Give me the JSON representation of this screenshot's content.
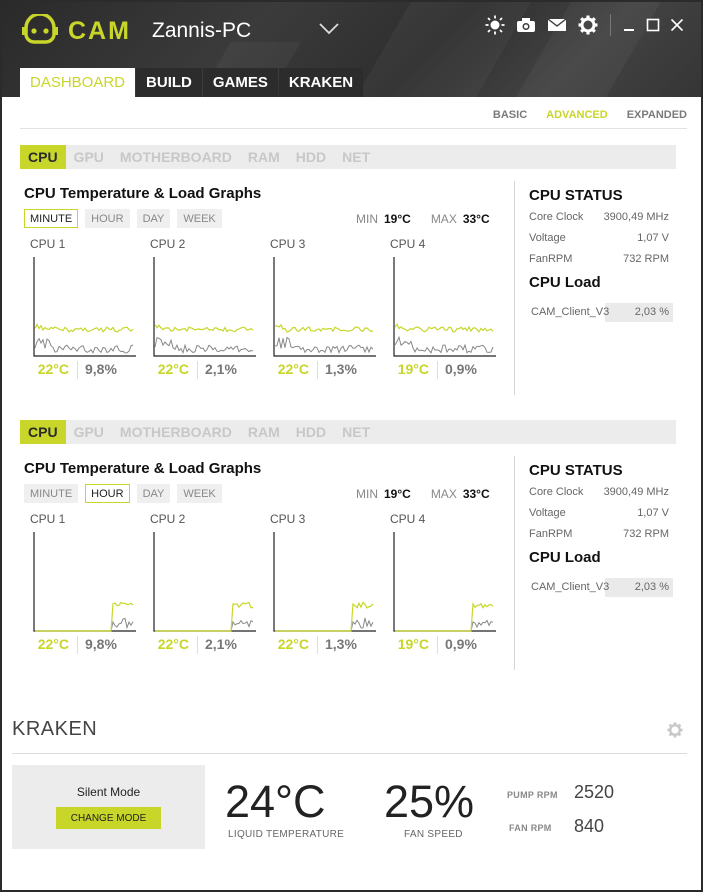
{
  "app": {
    "logo_text": "CAM",
    "pc_name": "Zannis-PC"
  },
  "top_icons": [
    "brightness-icon",
    "camera-icon",
    "mail-icon",
    "gear-icon",
    "minimize-icon",
    "maximize-icon",
    "close-icon"
  ],
  "main_tabs": [
    {
      "label": "DASHBOARD",
      "active": true
    },
    {
      "label": "BUILD",
      "active": false
    },
    {
      "label": "GAMES",
      "active": false
    },
    {
      "label": "KRAKEN",
      "active": false
    }
  ],
  "view_modes": [
    {
      "label": "BASIC",
      "active": false
    },
    {
      "label": "ADVANCED",
      "active": true
    },
    {
      "label": "EXPANDED",
      "active": false
    }
  ],
  "colors": {
    "accent": "#c8d62a",
    "header_bg": "#333333",
    "panel_gray": "#ececec"
  },
  "panels": [
    {
      "component_tabs": [
        "CPU",
        "GPU",
        "MOTHERBOARD",
        "RAM",
        "HDD",
        "NET"
      ],
      "active_component": "CPU",
      "title": "CPU Temperature & Load Graphs",
      "ranges": [
        {
          "label": "MINUTE",
          "active": true
        },
        {
          "label": "HOUR",
          "active": false
        },
        {
          "label": "DAY",
          "active": false
        },
        {
          "label": "WEEK",
          "active": false
        }
      ],
      "min_label": "MIN",
      "min_value": "19°C",
      "max_label": "MAX",
      "max_value": "33°C",
      "cores": [
        {
          "name": "CPU 1",
          "temp": "22°C",
          "load": "9,8%"
        },
        {
          "name": "CPU 2",
          "temp": "22°C",
          "load": "2,1%"
        },
        {
          "name": "CPU 3",
          "temp": "22°C",
          "load": "1,3%"
        },
        {
          "name": "CPU 4",
          "temp": "19°C",
          "load": "0,9%"
        }
      ],
      "status": {
        "title": "CPU STATUS",
        "core_clock_label": "Core Clock",
        "core_clock": "3900,49 MHz",
        "voltage_label": "Voltage",
        "voltage": "1,07 V",
        "fan_label": "FanRPM",
        "fan": "732 RPM",
        "load_title": "CPU Load",
        "load_app": "CAM_Client_V3",
        "load_pct": "2,03 %"
      }
    },
    {
      "component_tabs": [
        "CPU",
        "GPU",
        "MOTHERBOARD",
        "RAM",
        "HDD",
        "NET"
      ],
      "active_component": "CPU",
      "title": "CPU Temperature & Load Graphs",
      "ranges": [
        {
          "label": "MINUTE",
          "active": false
        },
        {
          "label": "HOUR",
          "active": true
        },
        {
          "label": "DAY",
          "active": false
        },
        {
          "label": "WEEK",
          "active": false
        }
      ],
      "min_label": "MIN",
      "min_value": "19°C",
      "max_label": "MAX",
      "max_value": "33°C",
      "cores": [
        {
          "name": "CPU 1",
          "temp": "22°C",
          "load": "9,8%"
        },
        {
          "name": "CPU 2",
          "temp": "22°C",
          "load": "2,1%"
        },
        {
          "name": "CPU 3",
          "temp": "22°C",
          "load": "1,3%"
        },
        {
          "name": "CPU 4",
          "temp": "19°C",
          "load": "0,9%"
        }
      ],
      "status": {
        "title": "CPU STATUS",
        "core_clock_label": "Core Clock",
        "core_clock": "3900,49 MHz",
        "voltage_label": "Voltage",
        "voltage": "1,07 V",
        "fan_label": "FanRPM",
        "fan": "732 RPM",
        "load_title": "CPU Load",
        "load_app": "CAM_Client_V3",
        "load_pct": "2,03 %"
      }
    }
  ],
  "kraken": {
    "title": "KRAKEN",
    "mode_name": "Silent Mode",
    "change_mode_label": "CHANGE MODE",
    "liquid_temp": "24°C",
    "liquid_temp_label": "LIQUID TEMPERATURE",
    "fan_speed": "25%",
    "fan_speed_label": "FAN SPEED",
    "pump_rpm_label": "PUMP RPM",
    "pump_rpm": "2520",
    "fan_rpm_label": "FAN RPM",
    "fan_rpm": "840"
  }
}
